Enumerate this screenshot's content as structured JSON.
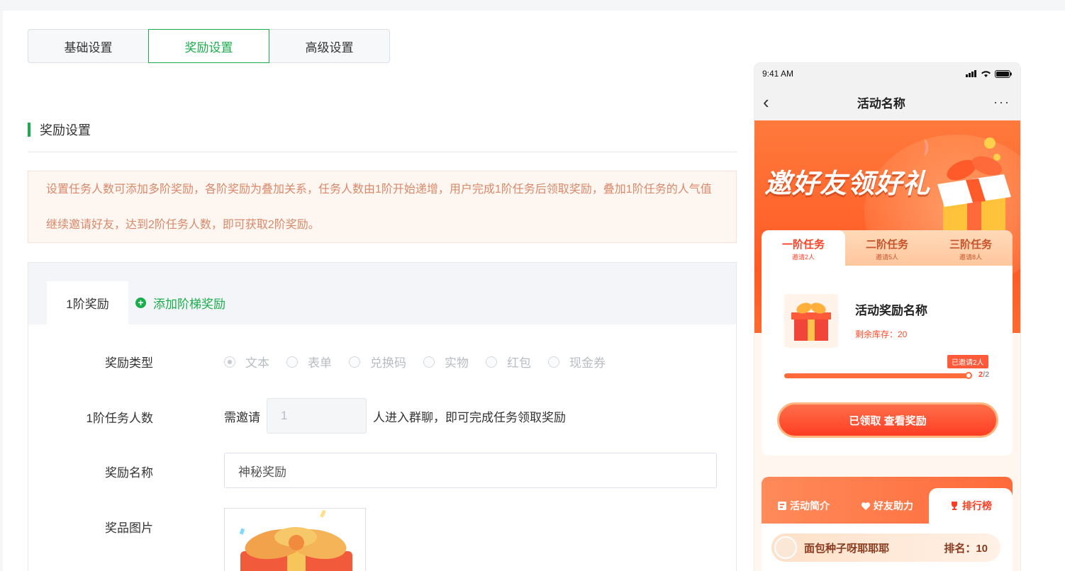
{
  "tabs": [
    {
      "label": "基础设置",
      "active": false
    },
    {
      "label": "奖励设置",
      "active": true
    },
    {
      "label": "高级设置",
      "active": false
    }
  ],
  "section": {
    "title": "奖励设置"
  },
  "notice": "设置任务人数可添加多阶奖励，各阶奖励为叠加关系，任务人数由1阶开始递增，用户完成1阶任务后领取奖励，叠加1阶任务的人气值继续邀请好友，达到2阶任务人数，即可获取2阶奖励。",
  "level_tabs": {
    "current": "1阶奖励",
    "add_label": "添加阶梯奖励"
  },
  "form": {
    "reward_type_label": "奖励类型",
    "reward_types": [
      "文本",
      "表单",
      "兑换码",
      "实物",
      "红包",
      "现金券"
    ],
    "reward_type_selected": "文本",
    "task_count_label": "1阶任务人数",
    "invite_prefix": "需邀请",
    "invite_value": "1",
    "invite_suffix": "人进入群聊，即可完成任务领取奖励",
    "reward_name_label": "奖励名称",
    "reward_name_value": "神秘奖励",
    "prize_image_label": "奖品图片"
  },
  "phone": {
    "time": "9:41 AM",
    "nav_title": "活动名称",
    "back": "‹",
    "more": "···",
    "hero_title": "邀好友领好礼",
    "task_tabs": [
      {
        "title": "一阶任务",
        "sub": "邀请2人",
        "active": true
      },
      {
        "title": "二阶任务",
        "sub": "邀请5人",
        "active": false
      },
      {
        "title": "三阶任务",
        "sub": "邀请8人",
        "active": false
      }
    ],
    "reward_name": "活动奖励名称",
    "stock": "剩余库存：20",
    "invited_badge": "已邀请2人",
    "progress_done": "2",
    "progress_total": "/2",
    "progress_fraction": 1.0,
    "cta": "已领取  查看奖励",
    "info_tabs": [
      {
        "label": "活动简介",
        "icon": "info-icon",
        "active": false
      },
      {
        "label": "好友助力",
        "icon": "heart-icon",
        "active": false
      },
      {
        "label": "排行榜",
        "icon": "trophy-icon",
        "active": true
      }
    ],
    "rank_user": "面包种子呀耶耶耶",
    "rank_text": "排名：10"
  },
  "colors": {
    "accent": "#1aad4b",
    "notice_text": "#d9896a",
    "promo": "#ff5a24"
  }
}
